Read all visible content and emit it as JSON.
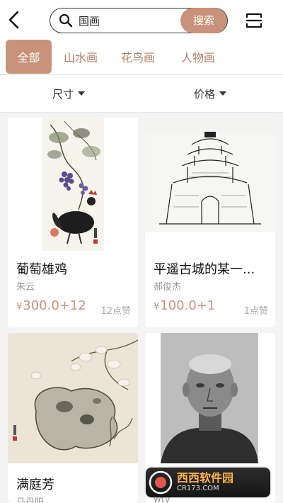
{
  "search": {
    "query": "国画",
    "button_label": "搜索"
  },
  "tabs": [
    {
      "label": "全部",
      "active": true
    },
    {
      "label": "山水画",
      "active": false
    },
    {
      "label": "花鸟画",
      "active": false
    },
    {
      "label": "人物画",
      "active": false
    }
  ],
  "filters": {
    "size_label": "尺寸",
    "price_label": "价格"
  },
  "cards": [
    {
      "title": "葡萄雄鸡",
      "artist": "朱云",
      "currency": "¥",
      "price": "300.0+12",
      "likes": "12点赞"
    },
    {
      "title": "平遥古城的某一...",
      "artist": "郝俊杰",
      "currency": "¥",
      "price": "100.0+1",
      "likes": "1点赞"
    },
    {
      "title": "满庭芳",
      "artist": "马丹阳",
      "currency": "",
      "price": "",
      "likes": ""
    },
    {
      "title": "",
      "artist": "wty",
      "currency": "",
      "price": "",
      "likes": ""
    }
  ],
  "watermark": {
    "brand": "西西软件园",
    "site": "CR173.COM"
  },
  "colors": {
    "accent": "#c8937a",
    "background": "#f4f4f4"
  }
}
